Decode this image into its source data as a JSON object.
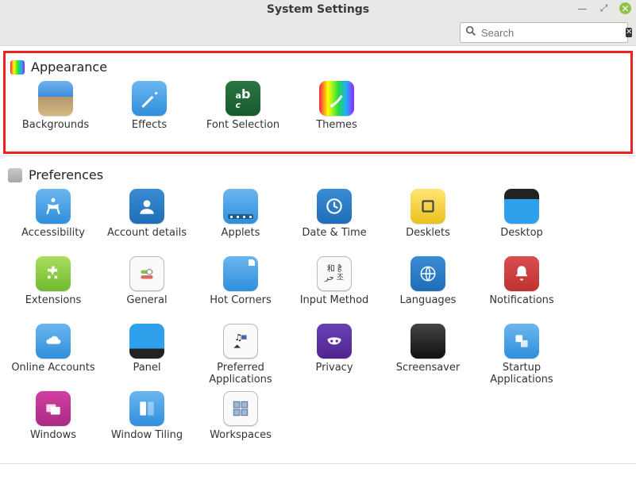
{
  "window": {
    "title": "System Settings",
    "search_placeholder": "Search"
  },
  "sections": {
    "appearance": {
      "title": "Appearance",
      "items": [
        {
          "label": "Backgrounds"
        },
        {
          "label": "Effects"
        },
        {
          "label": "Font Selection"
        },
        {
          "label": "Themes"
        }
      ]
    },
    "preferences": {
      "title": "Preferences",
      "items": [
        {
          "label": "Accessibility"
        },
        {
          "label": "Account details"
        },
        {
          "label": "Applets"
        },
        {
          "label": "Date & Time"
        },
        {
          "label": "Desklets"
        },
        {
          "label": "Desktop"
        },
        {
          "label": "Extensions"
        },
        {
          "label": "General"
        },
        {
          "label": "Hot Corners"
        },
        {
          "label": "Input Method"
        },
        {
          "label": "Languages"
        },
        {
          "label": "Notifications"
        },
        {
          "label": "Online Accounts"
        },
        {
          "label": "Panel"
        },
        {
          "label": "Preferred Applications"
        },
        {
          "label": "Privacy"
        },
        {
          "label": "Screensaver"
        },
        {
          "label": "Startup Applications"
        },
        {
          "label": "Windows"
        },
        {
          "label": "Window Tiling"
        },
        {
          "label": "Workspaces"
        }
      ]
    }
  }
}
